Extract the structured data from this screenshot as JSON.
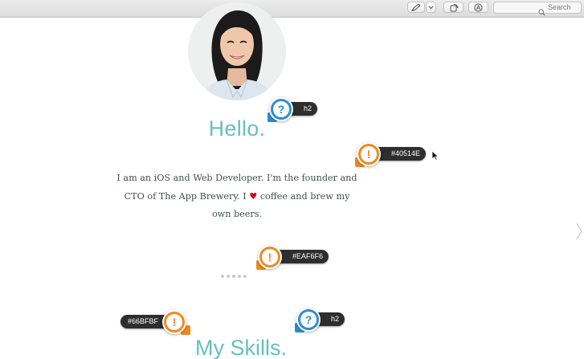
{
  "toolbar": {
    "search_placeholder": "Search",
    "icons": [
      "markup-pen-icon",
      "chevron-down-icon",
      "rotate-icon",
      "annotate-icon",
      "search-icon"
    ]
  },
  "profile": {
    "avatar_icon": "profile-photo",
    "heading": "Hello.",
    "bio_part1": "I am an iOS and Web Developer. I'm the founder and CTO of The App Brewery. I",
    "bio_heart": "♥",
    "bio_part2": "coffee and brew my own beers."
  },
  "carousel": {
    "dot_count": 5
  },
  "skills_heading": "My Skills.",
  "annotations": {
    "h2_top": {
      "label": "h2",
      "symbol": "?"
    },
    "color_text": {
      "label": "#40514E",
      "symbol": "!"
    },
    "color_bg": {
      "label": "#EAF6F6",
      "symbol": "!"
    },
    "color_heading": {
      "label": "#66BFBF",
      "symbol": "!"
    },
    "h2_bottom": {
      "label": "h2",
      "symbol": "?"
    }
  },
  "colors": {
    "heading": "#66BFBF",
    "text": "#40514E",
    "annotation_blue": "#2a8fd4",
    "annotation_orange": "#ef8a1f"
  }
}
